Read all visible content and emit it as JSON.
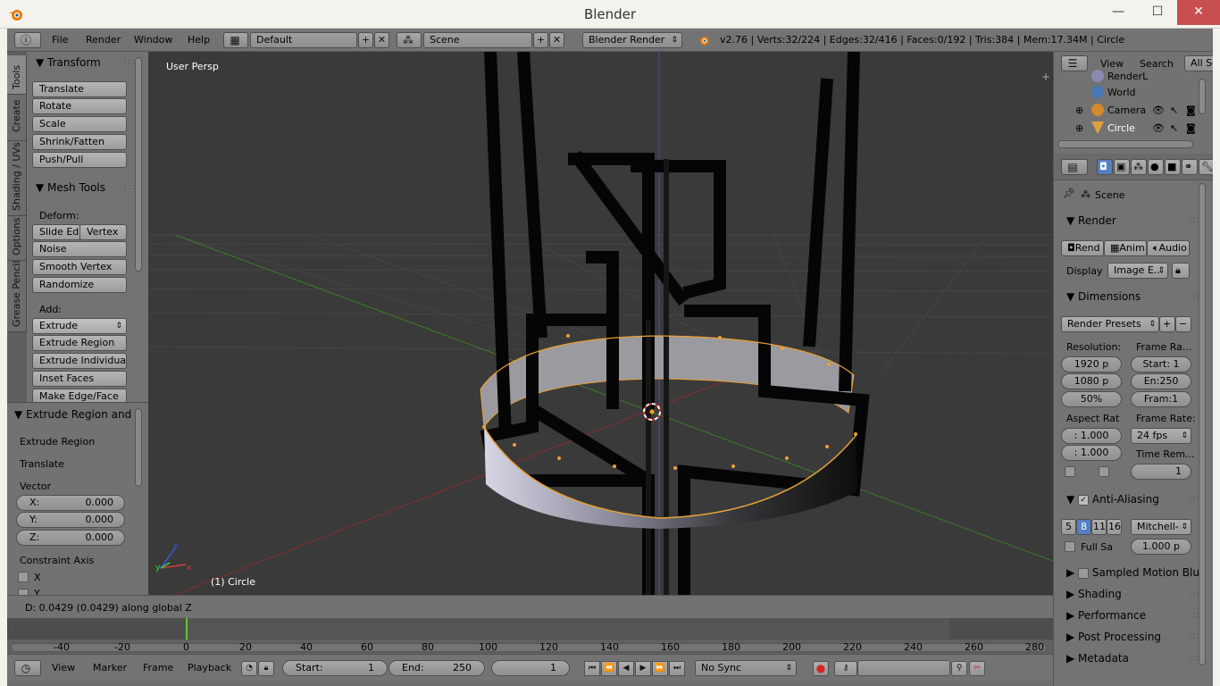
{
  "window": {
    "title": "Blender",
    "minimize": "—",
    "maximize": "☐",
    "close": "✕"
  },
  "header": {
    "menus": [
      "File",
      "Render",
      "Window",
      "Help"
    ],
    "layout": "Default",
    "scene": "Scene",
    "engine": "Blender Render",
    "stats": "v2.76 | Verts:32/224 | Edges:32/416 | Faces:0/192 | Tris:384 | Mem:17.34M | Circle"
  },
  "tool_tabs": [
    "Tools",
    "Create",
    "Shading / UVs",
    "Options",
    "Grease Pencil"
  ],
  "toolshelf": {
    "transform_title": "Transform",
    "transform_buttons": [
      "Translate",
      "Rotate",
      "Scale",
      "Shrink/Fatten",
      "Push/Pull"
    ],
    "mesh_tools_title": "Mesh Tools",
    "deform_label": "Deform:",
    "slide_edge": "Slide Ed",
    "vertex": "Vertex",
    "deform_buttons": [
      "Noise",
      "Smooth Vertex",
      "Randomize"
    ],
    "add_label": "Add:",
    "extrude": "Extrude",
    "add_buttons": [
      "Extrude Region",
      "Extrude Individual",
      "Inset Faces",
      "Make Edge/Face"
    ]
  },
  "operator": {
    "title": "Extrude Region and",
    "items": [
      "Extrude Region",
      "Translate"
    ],
    "vector_label": "Vector",
    "vector": [
      {
        "axis": "X:",
        "value": "0.000"
      },
      {
        "axis": "Y:",
        "value": "0.000"
      },
      {
        "axis": "Z:",
        "value": "0.000"
      }
    ],
    "constraint_label": "Constraint Axis",
    "constraint_x": "X",
    "constraint_y": "Y"
  },
  "viewport": {
    "view_label": "User Persp",
    "object_label": "(1) Circle"
  },
  "info": {
    "status": "D: 0.0429 (0.0429) along global Z"
  },
  "timeline": {
    "ticks": [
      "-40",
      "-20",
      "0",
      "20",
      "40",
      "60",
      "80",
      "100",
      "120",
      "140",
      "160",
      "180",
      "200",
      "220",
      "240",
      "260",
      "280"
    ],
    "menus": [
      "View",
      "Marker",
      "Frame",
      "Playback"
    ],
    "start_label": "Start:",
    "start_value": "1",
    "end_label": "End:",
    "end_value": "250",
    "current": "1",
    "sync": "No Sync"
  },
  "outliner": {
    "menus": [
      "View",
      "Search"
    ],
    "filter": "All Sc",
    "items": [
      "RenderL",
      "World",
      "Camera",
      "Circle"
    ]
  },
  "properties": {
    "context": "Scene",
    "render_title": "Render",
    "render_buttons": [
      "Rend",
      "Anim",
      "Audio"
    ],
    "display_label": "Display",
    "display_value": "Image E...",
    "dimensions_title": "Dimensions",
    "render_presets": "Render Presets",
    "resolution_label": "Resolution:",
    "res_x": "1920 p",
    "res_y": "1080 p",
    "res_pct": "50%",
    "frame_range_label": "Frame Ra...",
    "frame_start": "Start: 1",
    "frame_end": "En:250",
    "frame_step": "Fram:1",
    "aspect_label": "Aspect Rat",
    "aspect_x": ": 1.000",
    "aspect_y": ": 1.000",
    "frame_rate_label": "Frame Rate:",
    "frame_rate": "24 fps",
    "time_remap_label": "Time Rem...",
    "time_remap_value": "1",
    "aa_title": "Anti-Aliasing",
    "aa_samples": [
      "5",
      "8",
      "11",
      "16"
    ],
    "aa_filter": "Mitchell-",
    "full_sample": "Full Sa",
    "aa_size": "1.000 p",
    "collapsed_panels": [
      "Sampled Motion Blur",
      "Shading",
      "Performance",
      "Post Processing",
      "Metadata"
    ]
  }
}
